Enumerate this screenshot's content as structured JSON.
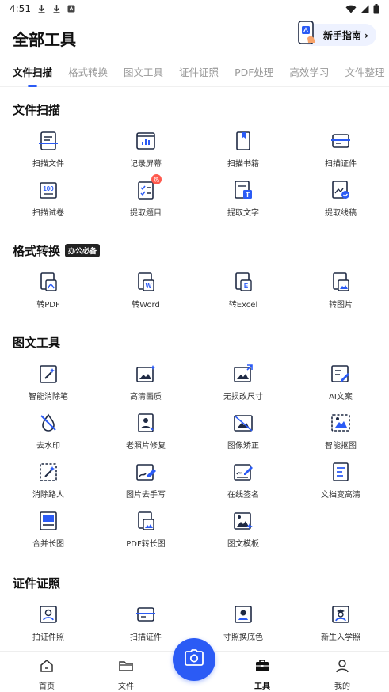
{
  "status": {
    "time": "4:51"
  },
  "header": {
    "title": "全部工具",
    "guide_label": "新手指南 ›"
  },
  "tabs": [
    "文件扫描",
    "格式转换",
    "图文工具",
    "证件证照",
    "PDF处理",
    "高效学习",
    "文件整理"
  ],
  "sections": {
    "scan": {
      "title": "文件扫描",
      "items": [
        "扫描文件",
        "记录屏幕",
        "扫描书籍",
        "扫描证件",
        "扫描试卷",
        "提取题目",
        "提取文字",
        "提取线稿"
      ],
      "hot_badge": "热"
    },
    "convert": {
      "title": "格式转换",
      "badge": "办公必备",
      "items": [
        "转PDF",
        "转Word",
        "转Excel",
        "转图片"
      ]
    },
    "image": {
      "title": "图文工具",
      "items": [
        "智能消除笔",
        "高清画质",
        "无损改尺寸",
        "AI文案",
        "去水印",
        "老照片修复",
        "图像矫正",
        "智能抠图",
        "消除路人",
        "图片去手写",
        "在线签名",
        "文档变高清",
        "合并长图",
        "PDF转长图",
        "图文模板"
      ]
    },
    "id": {
      "title": "证件证照",
      "items": [
        "拍证件照",
        "扫描证件",
        "寸照换底色",
        "新生入学照"
      ]
    }
  },
  "nav": {
    "home": "首页",
    "files": "文件",
    "tools": "工具",
    "mine": "我的"
  },
  "colors": {
    "accent": "#2b5bf5",
    "icon_dark": "#1f2a44"
  }
}
